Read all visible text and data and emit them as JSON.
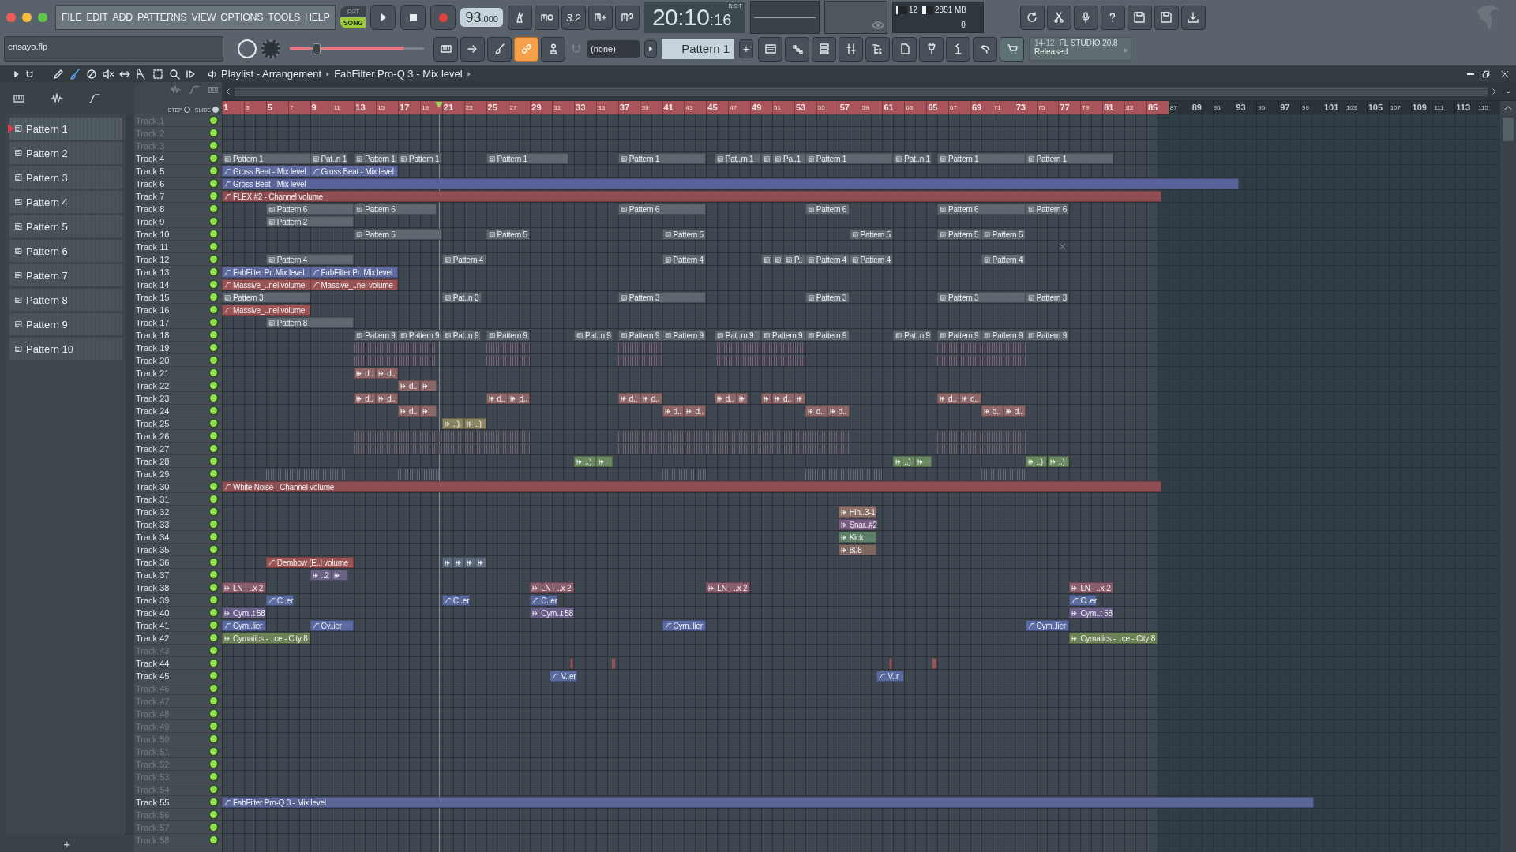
{
  "menu": [
    "FILE",
    "EDIT",
    "ADD",
    "PATTERNS",
    "VIEW",
    "OPTIONS",
    "TOOLS",
    "HELP"
  ],
  "mode": [
    {
      "label": "PAT",
      "selected": false
    },
    {
      "label": "SONG",
      "selected": true
    }
  ],
  "tempo": {
    "whole": "93",
    "fraction": ".000"
  },
  "countdown": "3.2",
  "time": {
    "main": "20:10",
    "ticks": ":16",
    "format": "B:S:T"
  },
  "cpu": {
    "value": "12",
    "level": 0.12
  },
  "memory": {
    "value": "2851 MB",
    "level": 0.35
  },
  "polyphony": "0",
  "hint": "ensayo.flp",
  "master_pitch": {
    "level": 0.2
  },
  "tools": [
    {
      "kind": "piano",
      "on": false
    },
    {
      "kind": "arrow",
      "on": false
    },
    {
      "kind": "brush",
      "on": false
    },
    {
      "kind": "link",
      "on": true
    },
    {
      "kind": "stamp",
      "on": false
    }
  ],
  "channel_filter": "(none)",
  "pattern_selector": {
    "value": "Pattern 1",
    "add": "+"
  },
  "news": {
    "date": "14-12",
    "title": "FL STUDIO 20.8",
    "subtitle": "Released"
  },
  "playlist": {
    "tools": [
      {
        "kind": "pencil",
        "selected": false
      },
      {
        "kind": "paint",
        "selected": true
      },
      {
        "kind": "delete",
        "selected": false
      },
      {
        "kind": "mute",
        "selected": false
      },
      {
        "kind": "slip",
        "selected": false
      },
      {
        "kind": "slice",
        "selected": false
      },
      {
        "kind": "select",
        "selected": false
      },
      {
        "kind": "zoom",
        "selected": false
      },
      {
        "kind": "playback",
        "selected": false
      }
    ],
    "breadcrumb": [
      "Playlist - Arrangement",
      "FabFilter Pro-Q 3 - Mix level"
    ],
    "snap": [
      {
        "label": "STEP",
        "on": false
      },
      {
        "label": "SLIDE",
        "on": true
      }
    ],
    "zoom_out": "-",
    "playhead": {
      "level": 0.17
    },
    "add_pattern": "+"
  },
  "patterns": [
    {
      "label": "Pattern 1",
      "selected": true
    },
    {
      "label": "Pattern 2",
      "selected": false
    },
    {
      "label": "Pattern 3",
      "selected": false
    },
    {
      "label": "Pattern 4",
      "selected": false
    },
    {
      "label": "Pattern 5",
      "selected": false
    },
    {
      "label": "Pattern 6",
      "selected": false
    },
    {
      "label": "Pattern 7",
      "selected": false
    },
    {
      "label": "Pattern 8",
      "selected": false
    },
    {
      "label": "Pattern 9",
      "selected": false
    },
    {
      "label": "Pattern 10",
      "selected": false
    }
  ],
  "ruler": [
    {
      "label": "1",
      "marked": true
    },
    {
      "label": "3",
      "marked": true
    },
    {
      "label": "5",
      "marked": true
    },
    {
      "label": "7",
      "marked": true
    },
    {
      "label": "9",
      "marked": true
    },
    {
      "label": "11",
      "marked": true
    },
    {
      "label": "13",
      "marked": true
    },
    {
      "label": "15",
      "marked": true
    },
    {
      "label": "17",
      "marked": true
    },
    {
      "label": "19",
      "marked": true
    },
    {
      "label": "21",
      "marked": true
    },
    {
      "label": "23",
      "marked": true
    },
    {
      "label": "25",
      "marked": true
    },
    {
      "label": "27",
      "marked": true
    },
    {
      "label": "29",
      "marked": true
    },
    {
      "label": "31",
      "marked": true
    },
    {
      "label": "33",
      "marked": true
    },
    {
      "label": "35",
      "marked": true
    },
    {
      "label": "37",
      "marked": true
    },
    {
      "label": "39",
      "marked": true
    },
    {
      "label": "41",
      "marked": true
    },
    {
      "label": "43",
      "marked": true
    },
    {
      "label": "45",
      "marked": true
    },
    {
      "label": "47",
      "marked": true
    },
    {
      "label": "49",
      "marked": true
    },
    {
      "label": "51",
      "marked": true
    },
    {
      "label": "53",
      "marked": true
    },
    {
      "label": "55",
      "marked": true
    },
    {
      "label": "57",
      "marked": true
    },
    {
      "label": "59",
      "marked": true
    },
    {
      "label": "61",
      "marked": true
    },
    {
      "label": "63",
      "marked": true
    },
    {
      "label": "65",
      "marked": true
    },
    {
      "label": "67",
      "marked": true
    },
    {
      "label": "69",
      "marked": true
    },
    {
      "label": "71",
      "marked": true
    },
    {
      "label": "73",
      "marked": true
    },
    {
      "label": "75",
      "marked": true
    },
    {
      "label": "77",
      "marked": true
    },
    {
      "label": "79",
      "marked": true
    },
    {
      "label": "81",
      "marked": true
    },
    {
      "label": "83",
      "marked": true
    },
    {
      "label": "85",
      "marked": true
    },
    {
      "label": "87",
      "marked": false
    },
    {
      "label": "89",
      "marked": false
    },
    {
      "label": "91",
      "marked": false
    },
    {
      "label": "93",
      "marked": false
    },
    {
      "label": "95",
      "marked": false
    },
    {
      "label": "97",
      "marked": false
    },
    {
      "label": "99",
      "marked": false
    },
    {
      "label": "101",
      "marked": false
    },
    {
      "label": "103",
      "marked": false
    },
    {
      "label": "105",
      "marked": false
    },
    {
      "label": "107",
      "marked": false
    },
    {
      "label": "109",
      "marked": false
    },
    {
      "label": "111",
      "marked": false
    },
    {
      "label": "113",
      "marked": false
    },
    {
      "label": "115",
      "marked": false
    }
  ],
  "tracks": [
    {
      "name": "Track 1",
      "active": false,
      "on": true
    },
    {
      "name": "Track 2",
      "active": false,
      "on": true
    },
    {
      "name": "Track 3",
      "active": false,
      "on": true
    },
    {
      "name": "Track 4",
      "active": true,
      "on": true,
      "clips": [
        {
          "kind": "pattern",
          "label": "Pattern 1"
        },
        {
          "kind": "pattern",
          "label": "Pat..n 1"
        },
        {
          "kind": "pattern",
          "label": "Pattern 1"
        },
        {
          "kind": "pattern",
          "label": "Pattern 1"
        },
        {
          "kind": "pattern",
          "label": "Pattern 1"
        },
        {
          "kind": "pattern",
          "label": "Pattern 1"
        },
        {
          "kind": "pattern",
          "label": "Pat..rn 1"
        },
        {
          "kind": "pattern"
        },
        {
          "kind": "pattern",
          "label": "Pa..1"
        },
        {
          "kind": "pattern",
          "label": "Pattern 1"
        },
        {
          "kind": "pattern",
          "label": "Pat..n 1"
        },
        {
          "kind": "pattern",
          "label": "Pattern 1"
        },
        {
          "kind": "pattern",
          "label": "Pattern 1"
        }
      ]
    },
    {
      "name": "Track 5",
      "active": true,
      "on": true,
      "clips": [
        {
          "kind": "automation",
          "label": "Gross Beat - Mix level",
          "color": "#5f6a9e"
        },
        {
          "kind": "automation",
          "label": "Gross Beat - Mix level",
          "color": "#5f6a9e"
        }
      ]
    },
    {
      "name": "Track 6",
      "active": true,
      "on": true,
      "clips": [
        {
          "kind": "automation",
          "label": "Gross Beat - Mix level",
          "color": "#59639a"
        }
      ]
    },
    {
      "name": "Track 7",
      "active": true,
      "on": true,
      "clips": [
        {
          "kind": "automation",
          "label": "FLEX #2 - Channel volume",
          "color": "#8f4f52"
        }
      ]
    },
    {
      "name": "Track 8",
      "active": true,
      "on": true,
      "clips": [
        {
          "kind": "pattern",
          "label": "Pattern 6"
        },
        {
          "kind": "pattern",
          "label": "Pattern 6"
        },
        {
          "kind": "pattern",
          "label": "Pattern 6"
        },
        {
          "kind": "pattern",
          "label": "Pattern 6"
        },
        {
          "kind": "pattern",
          "label": "Pattern 6"
        },
        {
          "kind": "pattern",
          "label": "Pattern 6"
        }
      ]
    },
    {
      "name": "Track 9",
      "active": true,
      "on": true,
      "clips": [
        {
          "kind": "pattern",
          "label": "Pattern 2"
        }
      ]
    },
    {
      "name": "Track 10",
      "active": true,
      "on": true,
      "clips": [
        {
          "kind": "pattern",
          "label": "Pattern 5"
        },
        {
          "kind": "pattern",
          "label": "Pattern 5"
        },
        {
          "kind": "pattern",
          "label": "Pattern 5"
        },
        {
          "kind": "pattern",
          "label": "Pattern 5"
        },
        {
          "kind": "pattern",
          "label": "Pattern 5"
        },
        {
          "kind": "pattern",
          "label": "Pattern 5"
        }
      ]
    },
    {
      "name": "Track 11",
      "active": true,
      "on": true,
      "clips": [
        {
          "kind": "cross"
        }
      ]
    },
    {
      "name": "Track 12",
      "active": true,
      "on": true,
      "clips": [
        {
          "kind": "pattern",
          "label": "Pattern 4"
        },
        {
          "kind": "pattern",
          "label": "Pattern 4"
        },
        {
          "kind": "pattern",
          "label": "Pattern 4"
        },
        {
          "kind": "pattern"
        },
        {
          "kind": "pattern"
        },
        {
          "kind": "pattern",
          "label": "P.."
        },
        {
          "kind": "pattern",
          "label": "Pattern 4"
        },
        {
          "kind": "pattern",
          "label": "Pattern 4"
        },
        {
          "kind": "pattern",
          "label": "Pattern 4"
        }
      ]
    },
    {
      "name": "Track 13",
      "active": true,
      "on": true,
      "clips": [
        {
          "kind": "automation",
          "label": "FabFilter Pr..Mix level",
          "color": "#5f6a9e"
        },
        {
          "kind": "automation",
          "label": "FabFilter Pr..Mix level",
          "color": "#5f6a9e"
        }
      ]
    },
    {
      "name": "Track 14",
      "active": true,
      "on": true,
      "clips": [
        {
          "kind": "automation",
          "label": "Massive_..nel volume",
          "color": "#9a5254"
        },
        {
          "kind": "automation",
          "label": "Massive_..nel volume",
          "color": "#9a5254"
        }
      ]
    },
    {
      "name": "Track 15",
      "active": true,
      "on": true,
      "clips": [
        {
          "kind": "pattern",
          "label": "Pattern 3"
        },
        {
          "kind": "pattern",
          "label": "Pat..n 3"
        },
        {
          "kind": "pattern",
          "label": "Pattern 3"
        },
        {
          "kind": "pattern",
          "label": "Pattern 3"
        },
        {
          "kind": "pattern",
          "label": "Pattern 3"
        },
        {
          "kind": "pattern",
          "label": "Pattern 3"
        }
      ]
    },
    {
      "name": "Track 16",
      "active": true,
      "on": true,
      "clips": [
        {
          "kind": "automation",
          "label": "Massive_..nel volume",
          "color": "#9a5254"
        }
      ]
    },
    {
      "name": "Track 17",
      "active": true,
      "on": true,
      "clips": [
        {
          "kind": "pattern",
          "label": "Pattern 8"
        }
      ]
    },
    {
      "name": "Track 18",
      "active": true,
      "on": true,
      "clips": [
        {
          "kind": "pattern",
          "label": "Pattern 9"
        },
        {
          "kind": "pattern",
          "label": "Pattern 9"
        },
        {
          "kind": "pattern",
          "label": "Pat..n 9"
        },
        {
          "kind": "pattern",
          "label": "Pattern 9"
        },
        {
          "kind": "pattern",
          "label": "Pat..n 9"
        },
        {
          "kind": "pattern",
          "label": "Pattern 9"
        },
        {
          "kind": "pattern",
          "label": "Pattern 9"
        },
        {
          "kind": "pattern",
          "label": "Pat..rn 9"
        },
        {
          "kind": "pattern",
          "label": "Pattern 9"
        },
        {
          "kind": "pattern",
          "label": "Pattern 9"
        },
        {
          "kind": "pattern",
          "label": "Pat..n 9"
        },
        {
          "kind": "pattern",
          "label": "Pattern 9"
        },
        {
          "kind": "pattern",
          "label": "Pattern 9"
        },
        {
          "kind": "pattern",
          "label": "Pattern 9"
        }
      ]
    },
    {
      "name": "Track 19",
      "active": true,
      "on": true,
      "clips": [
        {
          "kind": "slices",
          "color": "#7a5b72"
        },
        {
          "kind": "slices",
          "color": "#7a5b72"
        },
        {
          "kind": "slices",
          "color": "#7a5b72"
        },
        {
          "kind": "slices",
          "color": "#7a5b72"
        },
        {
          "kind": "slices",
          "color": "#7a5b72"
        }
      ]
    },
    {
      "name": "Track 20",
      "active": true,
      "on": true,
      "clips": [
        {
          "kind": "slices",
          "color": "#7a5b72"
        },
        {
          "kind": "slices",
          "color": "#7a5b72"
        },
        {
          "kind": "slices",
          "color": "#7a5b72"
        },
        {
          "kind": "slices",
          "color": "#7a5b72"
        },
        {
          "kind": "slices",
          "color": "#7a5b72"
        }
      ]
    },
    {
      "name": "Track 21",
      "active": true,
      "on": true,
      "clips": [
        {
          "kind": "audio",
          "label": "d..",
          "color": "#8d6767"
        },
        {
          "kind": "audio",
          "label": "d..",
          "color": "#8d6767"
        }
      ]
    },
    {
      "name": "Track 22",
      "active": true,
      "on": true,
      "clips": [
        {
          "kind": "audio",
          "label": "d..",
          "color": "#8d6767"
        },
        {
          "kind": "audio",
          "color": "#8d6767"
        }
      ]
    },
    {
      "name": "Track 23",
      "active": true,
      "on": true,
      "clips": [
        {
          "kind": "audio",
          "label": "d..",
          "color": "#8d6767"
        },
        {
          "kind": "audio",
          "label": "d..",
          "color": "#8d6767"
        },
        {
          "kind": "audio",
          "label": "d..",
          "color": "#8d6767"
        },
        {
          "kind": "audio",
          "label": "d..",
          "color": "#8d6767"
        },
        {
          "kind": "audio",
          "label": "d..",
          "color": "#8d6767"
        },
        {
          "kind": "audio",
          "label": "d..",
          "color": "#8d6767"
        },
        {
          "kind": "audio",
          "label": "d..",
          "color": "#8d6767"
        },
        {
          "kind": "audio",
          "color": "#8d6767"
        },
        {
          "kind": "audio",
          "color": "#8d6767"
        },
        {
          "kind": "audio",
          "label": "d..",
          "color": "#8d6767"
        },
        {
          "kind": "audio",
          "color": "#8d6767"
        },
        {
          "kind": "audio",
          "label": "d..",
          "color": "#8d6767"
        },
        {
          "kind": "audio",
          "label": "d..",
          "color": "#8d6767"
        }
      ]
    },
    {
      "name": "Track 24",
      "active": true,
      "on": true,
      "clips": [
        {
          "kind": "audio",
          "label": "d..",
          "color": "#8d6767"
        },
        {
          "kind": "audio",
          "color": "#8d6767"
        },
        {
          "kind": "audio",
          "label": "d..",
          "color": "#8d6767"
        },
        {
          "kind": "audio",
          "label": "d..",
          "color": "#8d6767"
        },
        {
          "kind": "audio",
          "label": "d..",
          "color": "#8d6767"
        },
        {
          "kind": "audio",
          "label": "d..",
          "color": "#8d6767"
        },
        {
          "kind": "audio",
          "label": "d..",
          "color": "#8d6767"
        },
        {
          "kind": "audio",
          "label": "d..",
          "color": "#8d6767"
        }
      ]
    },
    {
      "name": "Track 25",
      "active": true,
      "on": true,
      "clips": [
        {
          "kind": "audio",
          "label": "..)",
          "color": "#8a8460"
        },
        {
          "kind": "audio",
          "label": "..)",
          "color": "#8a8460"
        }
      ]
    },
    {
      "name": "Track 26",
      "active": true,
      "on": true,
      "clips": [
        {
          "kind": "slices",
          "color": "#6e5f6e"
        },
        {
          "kind": "slices",
          "color": "#6e5f6e"
        },
        {
          "kind": "slices",
          "color": "#6e5f6e"
        }
      ]
    },
    {
      "name": "Track 27",
      "active": true,
      "on": true,
      "clips": [
        {
          "kind": "slices",
          "color": "#6e5f6e"
        },
        {
          "kind": "slices",
          "color": "#6e5f6e"
        },
        {
          "kind": "slices",
          "color": "#6e5f6e"
        }
      ]
    },
    {
      "name": "Track 28",
      "active": true,
      "on": true,
      "clips": [
        {
          "kind": "audio",
          "label": "..)",
          "color": "#6c8a62"
        },
        {
          "kind": "audio",
          "color": "#6c8a62"
        },
        {
          "kind": "audio",
          "label": "..)",
          "color": "#6c8a62"
        },
        {
          "kind": "audio",
          "color": "#6c8a62"
        },
        {
          "kind": "audio",
          "label": "..)",
          "color": "#6c8a62"
        },
        {
          "kind": "audio",
          "label": "..)",
          "color": "#6c8a62"
        }
      ]
    },
    {
      "name": "Track 29",
      "active": true,
      "on": true,
      "clips": [
        {
          "kind": "slices",
          "color": "#5f6873"
        },
        {
          "kind": "slices",
          "color": "#5f6873"
        },
        {
          "kind": "slices",
          "color": "#5f6873"
        },
        {
          "kind": "slices",
          "color": "#5f6873"
        },
        {
          "kind": "slices",
          "color": "#5f6873"
        }
      ]
    },
    {
      "name": "Track 30",
      "active": true,
      "on": true,
      "clips": [
        {
          "kind": "automation",
          "label": "White Noise - Channel volume",
          "color": "#8f4f52"
        }
      ]
    },
    {
      "name": "Track 31",
      "active": true,
      "on": true
    },
    {
      "name": "Track 32",
      "active": true,
      "on": true,
      "clips": [
        {
          "kind": "audio",
          "label": "Hih..3-1",
          "color": "#8d706a"
        }
      ]
    },
    {
      "name": "Track 33",
      "active": true,
      "on": true,
      "clips": [
        {
          "kind": "audio",
          "label": "Snar..#2",
          "color": "#7b5e86"
        }
      ]
    },
    {
      "name": "Track 34",
      "active": true,
      "on": true,
      "clips": [
        {
          "kind": "audio",
          "label": "Kick",
          "color": "#5e8068"
        }
      ]
    },
    {
      "name": "Track 35",
      "active": true,
      "on": true,
      "clips": [
        {
          "kind": "audio",
          "label": "808",
          "color": "#7f6660"
        }
      ]
    },
    {
      "name": "Track 36",
      "active": true,
      "on": true,
      "clips": [
        {
          "kind": "automation",
          "label": "Dembow (E..l volume",
          "color": "#9a5252"
        },
        {
          "kind": "audio",
          "color": "#5f6a7c"
        },
        {
          "kind": "audio",
          "color": "#5f6a7c"
        },
        {
          "kind": "audio",
          "color": "#5f6a7c"
        },
        {
          "kind": "audio",
          "color": "#5f6a7c"
        }
      ]
    },
    {
      "name": "Track 37",
      "active": true,
      "on": true,
      "clips": [
        {
          "kind": "audio",
          "label": "..2",
          "color": "#6a6384"
        },
        {
          "kind": "audio",
          "color": "#6a6384"
        }
      ]
    },
    {
      "name": "Track 38",
      "active": true,
      "on": true,
      "clips": [
        {
          "kind": "audio",
          "label": "LN - ..x 2",
          "color": "#8a5e6c"
        },
        {
          "kind": "audio",
          "label": "LN - ..x 2",
          "color": "#8a5e6c"
        },
        {
          "kind": "audio",
          "label": "LN - ..x 2",
          "color": "#8a5e6c"
        },
        {
          "kind": "audio",
          "label": "LN - ..x 2",
          "color": "#8a5e6c"
        }
      ]
    },
    {
      "name": "Track 39",
      "active": true,
      "on": true,
      "clips": [
        {
          "kind": "automation",
          "label": "C..er",
          "color": "#5a6a9c"
        },
        {
          "kind": "automation",
          "label": "C..er",
          "color": "#5a6a9c"
        },
        {
          "kind": "automation",
          "label": "C..er",
          "color": "#5a6a9c"
        },
        {
          "kind": "automation",
          "label": "C..er",
          "color": "#5a6a9c"
        }
      ]
    },
    {
      "name": "Track 40",
      "active": true,
      "on": true,
      "clips": [
        {
          "kind": "audio",
          "label": "Cym..t 58",
          "color": "#6a5f88"
        },
        {
          "kind": "audio",
          "label": "Cym..t 58",
          "color": "#6a5f88"
        },
        {
          "kind": "audio",
          "label": "Cym..t 58",
          "color": "#6a5f88"
        }
      ]
    },
    {
      "name": "Track 41",
      "active": true,
      "on": true,
      "clips": [
        {
          "kind": "automation",
          "label": "Cym..lier",
          "color": "#5b6aa2"
        },
        {
          "kind": "automation",
          "label": "Cy..ier",
          "color": "#5b6aa2"
        },
        {
          "kind": "automation",
          "label": "Cym..lier",
          "color": "#5b6aa2"
        },
        {
          "kind": "automation",
          "label": "Cym..lier",
          "color": "#5b6aa2"
        }
      ]
    },
    {
      "name": "Track 42",
      "active": true,
      "on": true,
      "clips": [
        {
          "kind": "audio",
          "label": "Cymatics - ..ce - City 8",
          "color": "#6e8258"
        },
        {
          "kind": "audio",
          "label": "Cymatics - ..ce - City 8",
          "color": "#6e8258"
        }
      ]
    },
    {
      "name": "Track 43",
      "active": false,
      "on": true
    },
    {
      "name": "Track 44",
      "active": true,
      "on": true,
      "clips": [
        {
          "kind": "audio",
          "color": "#8a5a5e"
        },
        {
          "kind": "audio",
          "color": "#8a5a5e"
        },
        {
          "kind": "audio",
          "color": "#8a5a5e"
        },
        {
          "kind": "audio",
          "color": "#8a5a5e"
        }
      ]
    },
    {
      "name": "Track 45",
      "active": true,
      "on": true,
      "clips": [
        {
          "kind": "automation",
          "label": "V..er",
          "color": "#5a6a9c"
        },
        {
          "kind": "automation",
          "label": "V..r",
          "color": "#5a6a9c"
        }
      ]
    },
    {
      "name": "Track 46",
      "active": false,
      "on": true
    },
    {
      "name": "Track 47",
      "active": false,
      "on": true
    },
    {
      "name": "Track 48",
      "active": false,
      "on": true
    },
    {
      "name": "Track 49",
      "active": false,
      "on": true
    },
    {
      "name": "Track 50",
      "active": false,
      "on": true
    },
    {
      "name": "Track 51",
      "active": false,
      "on": true
    },
    {
      "name": "Track 52",
      "active": false,
      "on": true
    },
    {
      "name": "Track 53",
      "active": false,
      "on": true
    },
    {
      "name": "Track 54",
      "active": false,
      "on": true
    },
    {
      "name": "Track 55",
      "active": true,
      "on": true,
      "clips": [
        {
          "kind": "automation",
          "label": "FabFilter Pro-Q 3 - Mix level",
          "color": "#5b6596"
        }
      ]
    },
    {
      "name": "Track 56",
      "active": false,
      "on": true
    },
    {
      "name": "Track 57",
      "active": false,
      "on": true
    },
    {
      "name": "Track 58",
      "active": false,
      "on": true
    }
  ]
}
